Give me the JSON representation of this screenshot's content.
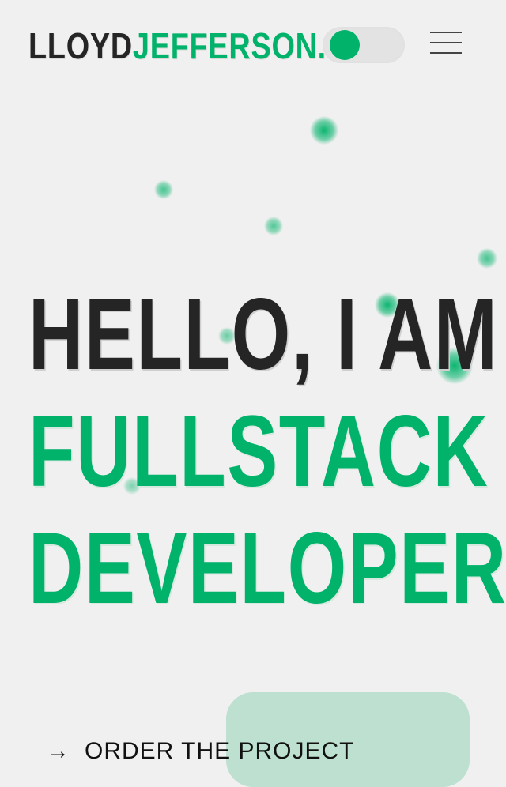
{
  "header": {
    "logo_part1": "LLOYD",
    "logo_part2": "JEFFERSON.",
    "theme_toggle": {
      "state": "on",
      "accent": "#00b26a"
    },
    "menu_icon": "hamburger-icon"
  },
  "hero": {
    "line1": "HELLO, I AM",
    "line2": "FULLSTACK",
    "line3": "DEVELOPER"
  },
  "cta": {
    "arrow_icon": "arrow-right-icon",
    "arrow": "→",
    "label": "ORDER THE PROJECT"
  },
  "colors": {
    "background": "#f0f0f0",
    "text_dark": "#252525",
    "accent": "#00b26a",
    "cta_bg": "#bde0d1"
  }
}
